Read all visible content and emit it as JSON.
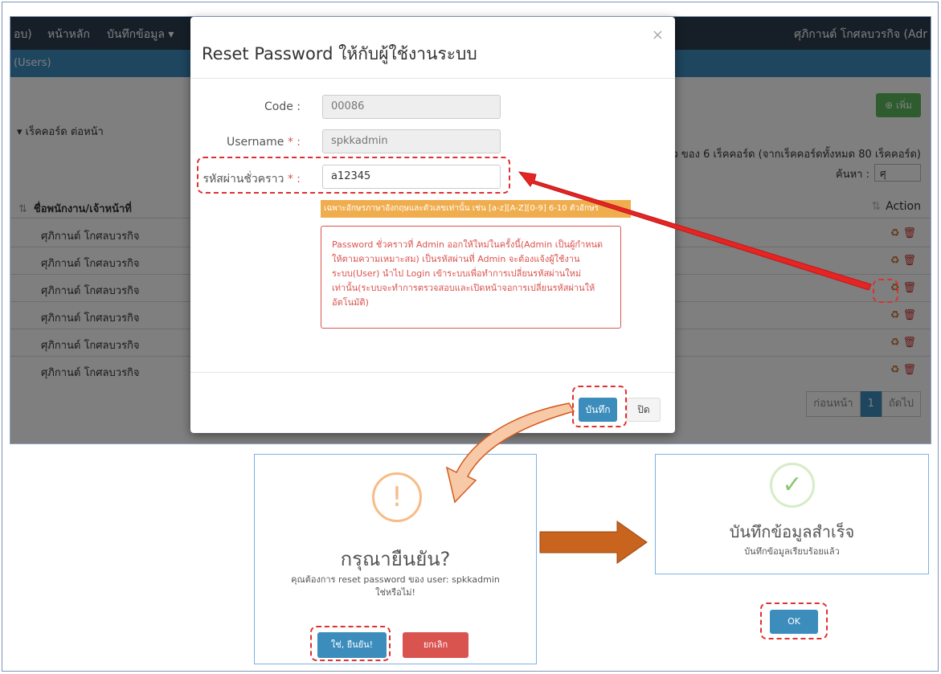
{
  "app": {
    "brand": "อบ)",
    "nav": [
      "หน้าหลัก",
      "บันทึกข้อมูล ▾"
    ],
    "user": "ศุภิกานต์ โกศลบวรกิจ (Adr",
    "panel_title": "(Users)",
    "add_label": "⊕ เพิ่ม",
    "per_page": "▾  เร็คคอร์ด ต่อหน้า",
    "showing": "ว ของ 6 เร็คคอร์ด (จากเร็คคอร์ดทั้งหมด 80 เร็คคอร์ด)",
    "search_label": "ค้นหา :",
    "search_value": "ศุ",
    "col_name": "ชื่อพนักงาน/เจ้าหน้าที่",
    "col_action": "Action",
    "rows": [
      "ศุภิกานต์ โกศลบวรกิจ",
      "ศุภิกานต์ โกศลบวรกิจ",
      "ศุภิกานต์ โกศลบวรกิจ",
      "ศุภิกานต์ โกศลบวรกิจ",
      "ศุภิกานต์ โกศลบวรกิจ",
      "ศุภิกานต์ โกศลบวรกิจ"
    ],
    "pager": {
      "prev": "ก่อนหน้า",
      "page": "1",
      "next": "ถัดไป"
    }
  },
  "modal": {
    "title": "Reset Password ให้กับผู้ใช้งานระบบ",
    "close": "×",
    "code_label": "Code :",
    "code_value": "00086",
    "username_label": "Username",
    "username_value": "spkkadmin",
    "temp_label": "รหัสผ่านชั่วคราว",
    "temp_value": "a12345",
    "req_mark": "* :",
    "hint": "เฉพาะอักษรภาษาอังกฤษและตัวเลขเท่านั้น เช่น [a-z][A-Z][0-9] 6-10 ตัวอักษร",
    "note": "Password ชั่วคราวที่ Admin ออกให้ใหม่ในครั้งนี้(Admin เป็นผู้กำหนดให้ตามความเหมาะสม) เป็นรหัสผ่านที่ Admin จะต้องแจ้งผู้ใช้งานระบบ(User) นำไป Login เข้าระบบเพื่อทำการเปลี่ยนรหัสผ่านใหม่เท่านั้น(ระบบจะทำการตรวจสอบและเปิดหน้าจอการเปลี่ยนรหัสผ่านให้อัตโนมัติ)",
    "save": "บันทึก",
    "close_btn": "ปิด"
  },
  "confirm": {
    "icon": "!",
    "title": "กรุณายืนยัน?",
    "text": "คุณต้องการ reset password ของ user: spkkadmin ใช่หรือไม่!",
    "yes": "ใช่, ยืนยัน!",
    "cancel": "ยกเลิก"
  },
  "success": {
    "icon": "✓",
    "title": "บันทึกข้อมูลสำเร็จ",
    "text": "บันทึกข้อมูลเรียบร้อยแล้ว",
    "ok": "OK"
  },
  "colors": {
    "navbar": "#2d3e50",
    "primary": "#3c8dbc",
    "success": "#5cb85c",
    "danger": "#d9534f",
    "warning": "#f0ad4e",
    "highlight": "#e03030"
  }
}
